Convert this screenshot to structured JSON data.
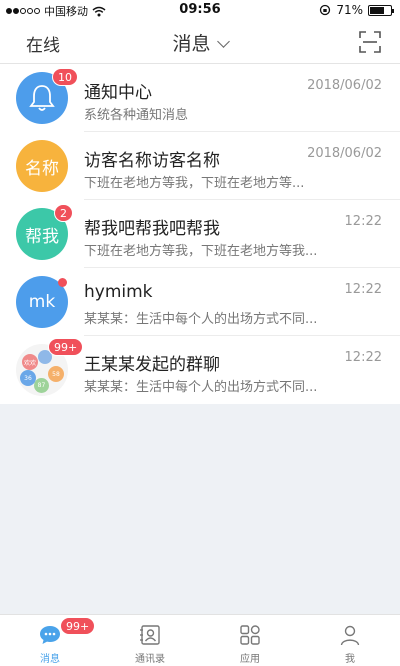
{
  "statusbar": {
    "carrier": "中国移动",
    "time": "09:56",
    "battery": "71%",
    "battery_level": 0.71
  },
  "navbar": {
    "left": "在线",
    "title": "消息"
  },
  "conversations": [
    {
      "title": "通知中心",
      "subtitle": "系统各种通知消息",
      "time": "2018/06/02",
      "badge": "10",
      "avatar_text": "",
      "avatar_color": "#4d9deb"
    },
    {
      "title": "访客名称访客名称",
      "subtitle": "下班在老地方等我，下班在老地方等...",
      "time": "2018/06/02",
      "badge": "",
      "avatar_text": "名称",
      "avatar_color": "#f7b33d"
    },
    {
      "title": "帮我吧帮我吧帮我",
      "subtitle": "下班在老地方等我，下班在老地方等我...",
      "time": "12:22",
      "badge": "2",
      "avatar_text": "帮我",
      "avatar_color": "#3cc8a8"
    },
    {
      "title": "hymimk",
      "subtitle": "某某某：生活中每个人的出场方式不同...",
      "time": "12:22",
      "badge": "",
      "avatar_text": "mk",
      "avatar_color": "#4d9deb"
    },
    {
      "title": "王某某发起的群聊",
      "subtitle": "某某某：生活中每个人的出场方式不同...",
      "time": "12:22",
      "badge": "99+",
      "avatar_text": "",
      "avatar_color": "#f4f4f4"
    }
  ],
  "group_avatar_labels": [
    "欢欢",
    "36",
    "58",
    "87"
  ],
  "tabs": [
    {
      "label": "消息",
      "badge": "99+",
      "icon": "chat-icon"
    },
    {
      "label": "通讯录",
      "badge": "",
      "icon": "contacts-icon"
    },
    {
      "label": "应用",
      "badge": "",
      "icon": "apps-icon"
    },
    {
      "label": "我",
      "badge": "",
      "icon": "person-icon"
    }
  ],
  "colors": {
    "accent": "#4aa3ea",
    "badge": "#f0505a",
    "background": "#eef1f5"
  }
}
